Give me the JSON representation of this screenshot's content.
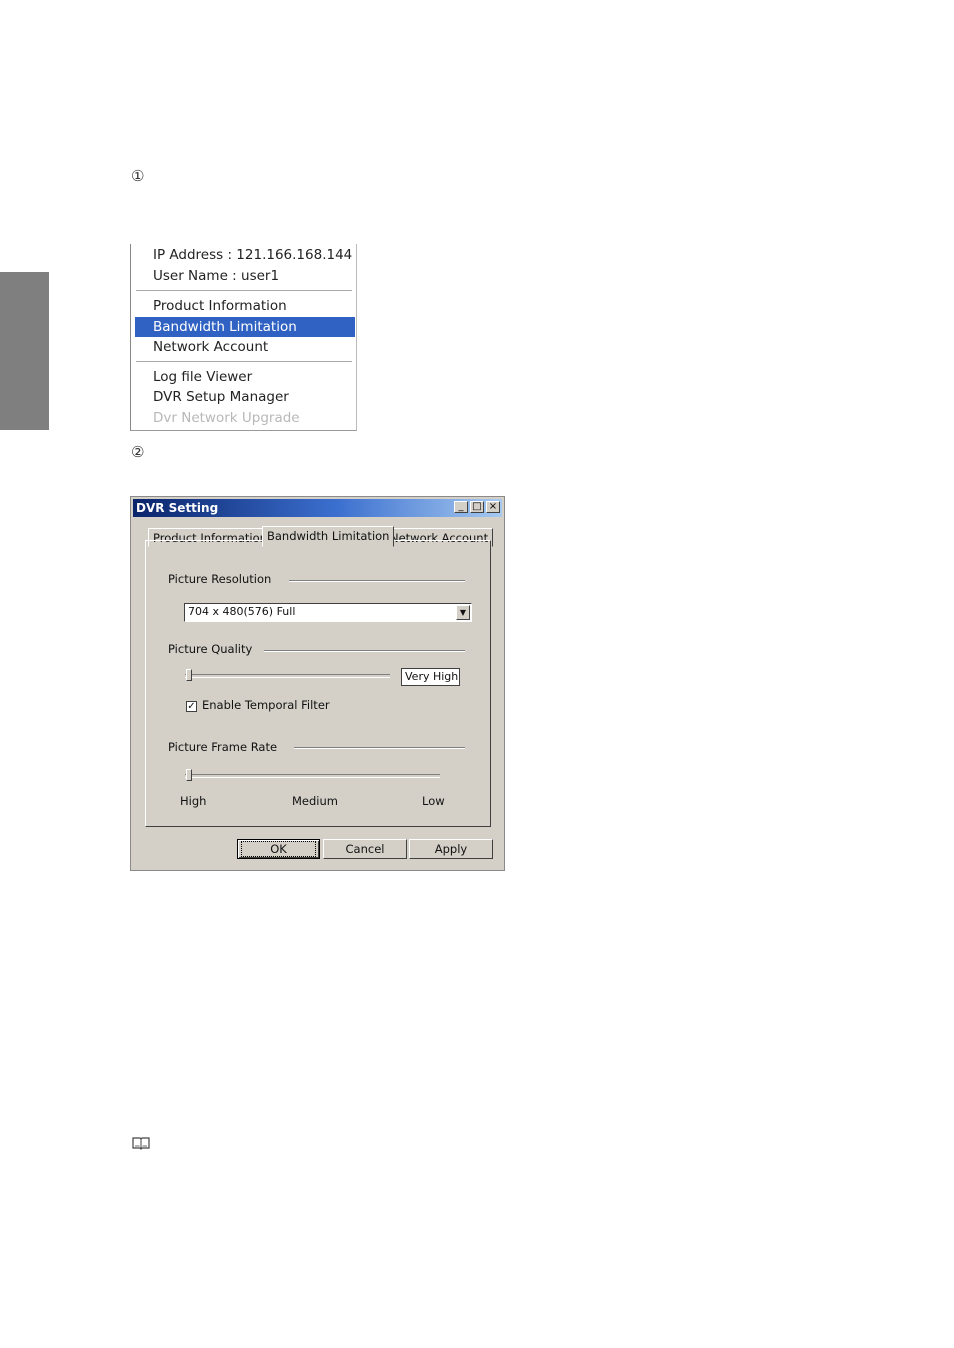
{
  "steps": {
    "step1": "①",
    "step2": "②"
  },
  "note_icon": "book-icon",
  "context_menu": {
    "ip_address": "IP Address : 121.166.168.144",
    "user_name": "User Name : user1",
    "items": [
      "Product Information",
      "Bandwidth Limitation",
      "Network Account",
      "Log file Viewer",
      "DVR Setup Manager",
      "Dvr Network Upgrade"
    ],
    "highlighted": "Bandwidth Limitation",
    "disabled": "Dvr Network Upgrade",
    "highlight_color": "#2f62c2"
  },
  "dialog": {
    "title": "DVR Setting",
    "title_buttons": [
      "_",
      "□",
      "×"
    ],
    "tabs": [
      "Product Information",
      "Bandwidth Limitation",
      "Network Account"
    ],
    "active_tab": "Bandwidth Limitation",
    "picture_resolution": {
      "label": "Picture Resolution",
      "value": "704 x 480(576) Full"
    },
    "picture_quality": {
      "label": "Picture Quality",
      "value": "Very High",
      "slider_level": 0
    },
    "temporal_filter": {
      "label": "Enable Temporal Filter",
      "checked": true,
      "check_mark": "✓"
    },
    "picture_frame_rate": {
      "label": "Picture Frame Rate",
      "slider_level": 0,
      "ticks": [
        "High",
        "Medium",
        "Low"
      ]
    },
    "buttons": {
      "ok": "OK",
      "cancel": "Cancel",
      "apply": "Apply"
    }
  }
}
